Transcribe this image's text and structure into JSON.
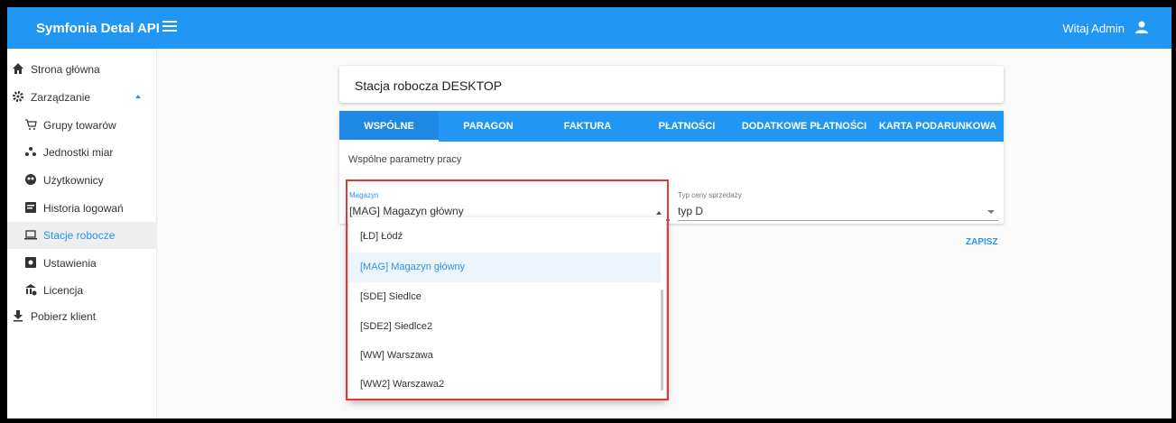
{
  "header": {
    "app_title": "Symfonia Detal API",
    "greeting": "Witaj Admin",
    "menu_icon": "hamburger-menu-icon",
    "user_icon": "user-icon"
  },
  "sidebar": {
    "items": [
      {
        "label": "Strona główna",
        "icon": "home-icon"
      },
      {
        "label": "Zarządzanie",
        "icon": "gear-icon",
        "expanded": true
      },
      {
        "label": "Grupy towarów",
        "icon": "cart-icon"
      },
      {
        "label": "Jednostki miar",
        "icon": "dots-icon"
      },
      {
        "label": "Użytkownicy",
        "icon": "users-icon"
      },
      {
        "label": "Historia logowań",
        "icon": "history-icon"
      },
      {
        "label": "Stacje robocze",
        "icon": "laptop-icon",
        "active": true
      },
      {
        "label": "Ustawienia",
        "icon": "settings-box-icon"
      },
      {
        "label": "Licencja",
        "icon": "license-icon"
      },
      {
        "label": "Pobierz klient",
        "icon": "download-icon"
      }
    ]
  },
  "main": {
    "title": "Stacja robocza DESKTOP",
    "tabs": [
      "WSPÓLNE",
      "PARAGON",
      "FAKTURA",
      "PŁATNOŚCI",
      "DODATKOWE PŁATNOŚCI",
      "KARTA PODARUNKOWA"
    ],
    "active_tab": "WSPÓLNE",
    "section_title": "Wspólne parametry pracy",
    "warehouse": {
      "label": "Magazyn",
      "value": "[MAG] Magazyn główny"
    },
    "price_type": {
      "label": "Typ ceny sprzedaży",
      "value": "typ D"
    },
    "save_label": "ZAPISZ",
    "dropdown_options": [
      {
        "label": "[ŁD] Łódź"
      },
      {
        "label": "[MAG] Magazyn główny",
        "selected": true
      },
      {
        "label": "[SDE] Siedlce"
      },
      {
        "label": "[SDE2] Siedlce2"
      },
      {
        "label": "[WW] Warszawa"
      },
      {
        "label": "[WW2] Warszawa2"
      }
    ]
  },
  "colors": {
    "primary": "#2196f3",
    "highlight_border": "#e53935"
  }
}
